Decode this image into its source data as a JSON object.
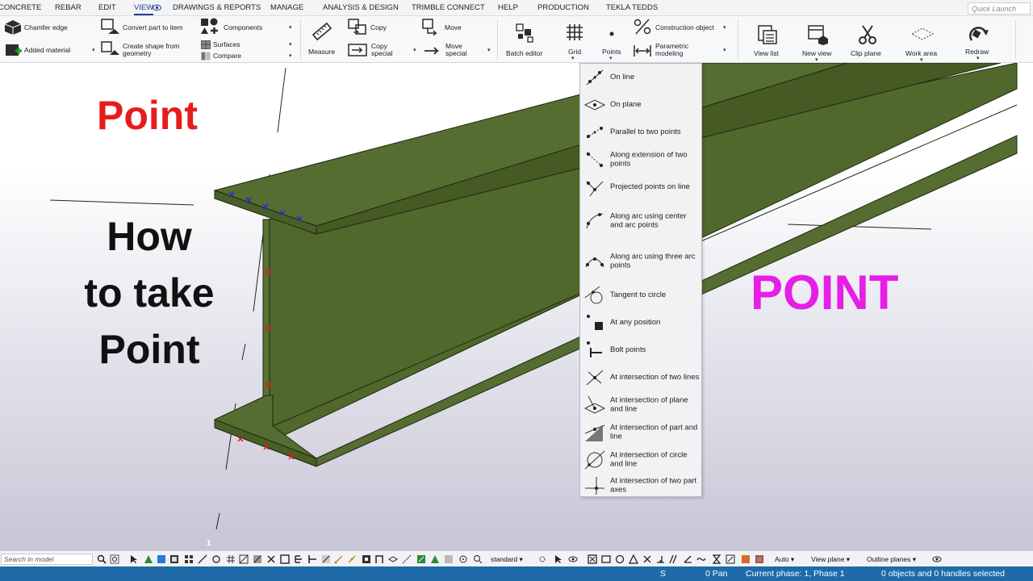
{
  "menu_tabs": [
    "CONCRETE",
    "REBAR",
    "EDIT",
    "VIEW",
    "DRAWINGS & REPORTS",
    "MANAGE",
    "ANALYSIS & DESIGN",
    "TRIMBLE CONNECT",
    "HELP",
    "PRODUCTION",
    "TEKLA TEDDS"
  ],
  "active_tab": "VIEW",
  "quick_launch_placeholder": "Quick Launch",
  "ribbon": {
    "chamfer_edge": "Chamfer edge",
    "added_material": "Added material",
    "convert_part": "Convert part to item",
    "create_shape_1": "Create shape from",
    "create_shape_2": "geometry",
    "components": "Components",
    "surfaces": "Surfaces",
    "compare": "Compare",
    "measure": "Measure",
    "copy": "Copy",
    "copy_special_1": "Copy",
    "copy_special_2": "special",
    "move": "Move",
    "move_special_1": "Move",
    "move_special_2": "special",
    "batch_editor": "Batch editor",
    "grid": "Grid",
    "points": "Points",
    "construction_object": "Construction object",
    "parametric_1": "Parametric",
    "parametric_2": "modeling",
    "view_list": "View list",
    "new_view": "New view",
    "clip_plane": "Clip plane",
    "work_area": "Work area",
    "redraw": "Redraw"
  },
  "overlay": {
    "title_red": "Point",
    "how_lines": [
      "How",
      "to take",
      "Point"
    ],
    "title_magenta": "POINT"
  },
  "points_menu": [
    {
      "label": "On line",
      "icon": "on-line-icon"
    },
    {
      "label": "On plane",
      "icon": "on-plane-icon"
    },
    {
      "label": "Parallel to two points",
      "icon": "parallel-points-icon"
    },
    {
      "label": "Along extension of two points",
      "icon": "extension-points-icon"
    },
    {
      "label": "Projected points on line",
      "icon": "projected-points-icon"
    },
    {
      "label": "Along arc using center and arc points",
      "icon": "arc-center-icon"
    },
    {
      "label": "Along arc using three arc points",
      "icon": "arc-three-points-icon"
    },
    {
      "label": "Tangent to circle",
      "icon": "tangent-circle-icon"
    },
    {
      "label": "At any position",
      "icon": "any-position-icon"
    },
    {
      "label": "Bolt points",
      "icon": "bolt-points-icon"
    },
    {
      "label": "At intersection of two lines",
      "icon": "intersection-lines-icon"
    },
    {
      "label": "At intersection of plane and line",
      "icon": "intersection-plane-line-icon"
    },
    {
      "label": "At intersection of part and line",
      "icon": "intersection-part-line-icon"
    },
    {
      "label": "At intersection of circle and line",
      "icon": "intersection-circle-line-icon"
    },
    {
      "label": "At intersection of two part axes",
      "icon": "intersection-part-axes-icon"
    }
  ],
  "viewport_label": "1",
  "bottom": {
    "search_placeholder": "Search in model",
    "standard": "standard",
    "auto": "Auto",
    "view_plane": "View plane",
    "outline_planes": "Outline planes"
  },
  "status": {
    "s": "S",
    "pan": "0  Pan",
    "phase": "Current phase: 1, Phase 1",
    "selected": "0 objects and 0 handles selected"
  },
  "colors": {
    "beam": "#556b2f",
    "status_bar": "#1e6ba8",
    "title_red": "#e61c1c",
    "title_magenta": "#e61ee6"
  }
}
